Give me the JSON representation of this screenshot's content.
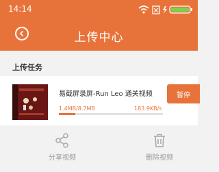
{
  "status_bar": {
    "time": "14:14",
    "battery_level": 1.0
  },
  "header": {
    "title": "上传中心",
    "back_icon": "back-arrow-icon"
  },
  "section": {
    "label": "上传任务"
  },
  "task": {
    "name": "易截屏录屏-Run Leo 通关视频",
    "uploaded": "1.4MB/8.7MB",
    "speed": "183.9KB/s",
    "progress": 0.16,
    "pause_label": "暂停"
  },
  "actions": {
    "share_label": "分享视频",
    "delete_label": "删除视频"
  },
  "colors": {
    "accent": "#e8733a"
  }
}
